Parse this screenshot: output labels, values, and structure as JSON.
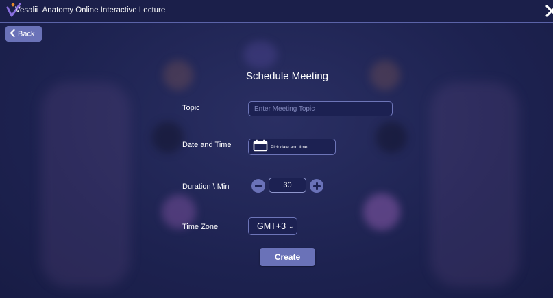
{
  "window": {
    "title": "Anatomy Online Interactive Lecture",
    "logo_text": "Vesalii",
    "logo_icon": "vesalii-check-logo",
    "close_icon": "close-x-icon"
  },
  "nav": {
    "back_label": "Back",
    "back_icon": "chevron-left-icon"
  },
  "form": {
    "heading": "Schedule Meeting",
    "topic": {
      "label": "Topic",
      "placeholder": "Enter Meeting Topic",
      "value": ""
    },
    "datetime": {
      "label": "Date and Time",
      "placeholder": "Pick date and time",
      "icon": "calendar-icon"
    },
    "duration": {
      "label": "Duration \\ Min",
      "value": "30",
      "decrement_icon": "minus-circle-icon",
      "increment_icon": "plus-circle-icon"
    },
    "timezone": {
      "label": "Time Zone",
      "selected": "GMT+3"
    },
    "submit_label": "Create"
  },
  "colors": {
    "background": "#1e2350",
    "titlebar": "#1b1f4a",
    "accent": "#6a72b8",
    "field_border": "#6d75b8",
    "placeholder": "#7e84b8"
  }
}
